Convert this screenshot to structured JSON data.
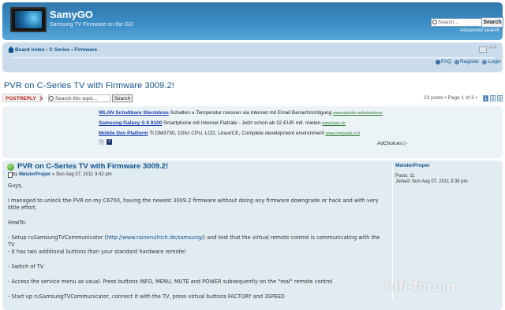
{
  "header": {
    "site_title": "SamyGO",
    "site_desc": "Samsung TV Firmware on the GO",
    "search_placeholder": "Search...",
    "search_button": "Search",
    "advanced_search": "Advanced search"
  },
  "nav": {
    "breadcrumb": [
      "Board index",
      "C Series",
      "Firmware"
    ],
    "sep": "‹",
    "faq": "FAQ",
    "register": "Register",
    "login": "Login"
  },
  "topic": {
    "title": "PVR on C-Series TV with Firmware 3009.2!",
    "reply_button": "POSTREPLY",
    "search_placeholder": "Search this topic...",
    "search_button": "Search",
    "pagination_text": "23 posts • Page 1 of 3 •",
    "pages": [
      "1",
      "2",
      "3"
    ]
  },
  "ads": {
    "items": [
      {
        "title": "WLAN Schaltbare Steckdose",
        "text": "Schalten u.Temperatur messen via Internet mit Email Benachrichtigung",
        "url": "www.waehke-websteckdose"
      },
      {
        "title": "Samsung Galaxy S II 9100",
        "text": "Smartphone mit Internet Flatrate - Jetzt schon ab 32 EUR mtl. mieten",
        "url": "www.base.de"
      },
      {
        "title": "Mobile Dev Platform",
        "text": "TI DM3730, 1Ghz CPU, LCD, Linux/CE, Complete development environment",
        "url": "www.compulab.co.il"
      }
    ],
    "prev": "‹",
    "next": "›",
    "adchoices": "AdChoices"
  },
  "post": {
    "title": "PVR on C-Series TV with Firmware 3009.2!",
    "by": "by",
    "author": "MeisterProper",
    "date": "» Sun Aug 07, 2011 3:42 pm",
    "posts": "Posts: 11",
    "joined": "Joined: Sun Aug 07, 2011 3:35 pm",
    "body": {
      "greet": "Guys,",
      "p1": "I managed to unlock the PVR on my C6700, having the newest 3009.2 firmware without doing any firmware downgrade or hack and with very little effort.",
      "howto": "HowTo:",
      "s1_pre": "- Setup ruSamsungTVCommunicator (",
      "s1_link": "http://www.rainerullrich.de/samsung/",
      "s1_post": ") and test that the virtual remote control is communicating with the TV",
      "s1b": "- it has two additional buttons than your standard hardware remote!",
      "s2": "- Switch of TV",
      "s3": "- Access the service menu as usual: Press buttons INFO, MENU, MUTE and POWER subsequently on the \"real\" remote control",
      "s4": "- Start up ruSamsungTVCommunicator, connect it with the TV, press virtual buttons FACTORY and 3SPEED"
    }
  },
  "watermark": "hifi-forum"
}
